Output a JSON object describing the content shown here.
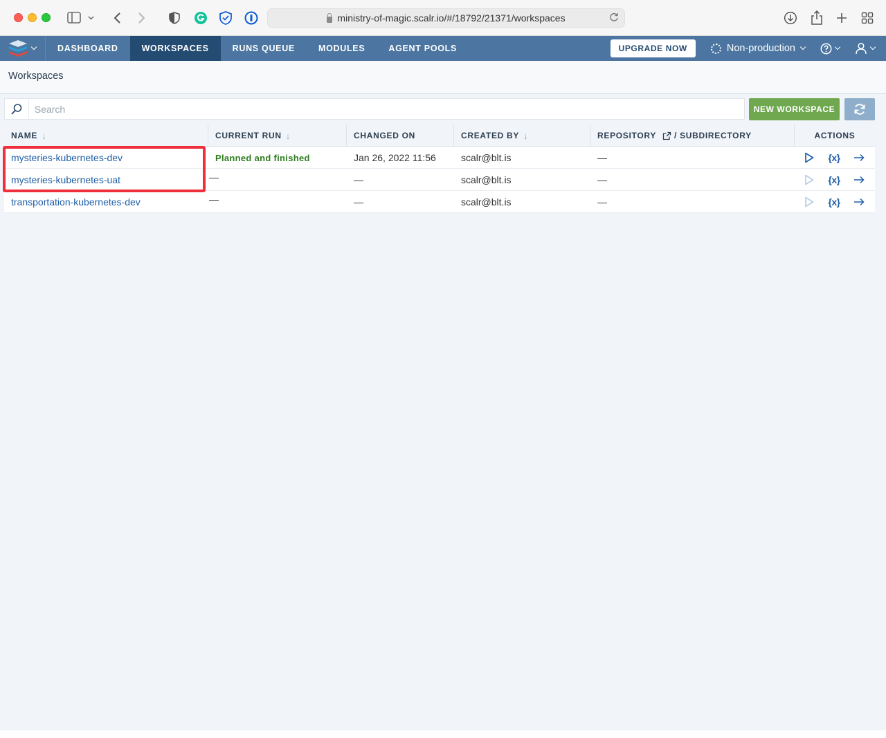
{
  "browser": {
    "url": "ministry-of-magic.scalr.io/#/18792/21371/workspaces"
  },
  "nav": {
    "items": [
      {
        "label": "DASHBOARD",
        "active": false
      },
      {
        "label": "WORKSPACES",
        "active": true
      },
      {
        "label": "RUNS QUEUE",
        "active": false
      },
      {
        "label": "MODULES",
        "active": false
      },
      {
        "label": "AGENT POOLS",
        "active": false
      }
    ],
    "upgrade_label": "UPGRADE NOW",
    "environment": "Non-production"
  },
  "page": {
    "title": "Workspaces"
  },
  "toolbar": {
    "search_placeholder": "Search",
    "new_workspace_label": "NEW WORKSPACE"
  },
  "table": {
    "columns": {
      "name": "NAME",
      "current_run": "CURRENT RUN",
      "changed_on": "CHANGED ON",
      "created_by": "CREATED BY",
      "repository": "REPOSITORY",
      "subdirectory": "/ SUBDIRECTORY",
      "actions": "ACTIONS"
    },
    "rows": [
      {
        "name": "mysteries-kubernetes-dev",
        "current_run": "Planned and finished",
        "changed_on": "Jan 26, 2022 11:56",
        "created_by": "scalr@blt.is",
        "repository": "—",
        "run_enabled": true
      },
      {
        "name": "mysteries-kubernetes-uat",
        "current_run": "—",
        "changed_on": "—",
        "created_by": "scalr@blt.is",
        "repository": "—",
        "run_enabled": false
      },
      {
        "name": "transportation-kubernetes-dev",
        "current_run": "—",
        "changed_on": "—",
        "created_by": "scalr@blt.is",
        "repository": "—",
        "run_enabled": false
      }
    ]
  },
  "colors": {
    "nav_bg": "#4c76a1",
    "nav_active": "#244b72",
    "link": "#1f5fa7",
    "status_ok": "#2e7d1f",
    "new_button": "#6fa84f",
    "highlight": "#ef2f3c"
  }
}
